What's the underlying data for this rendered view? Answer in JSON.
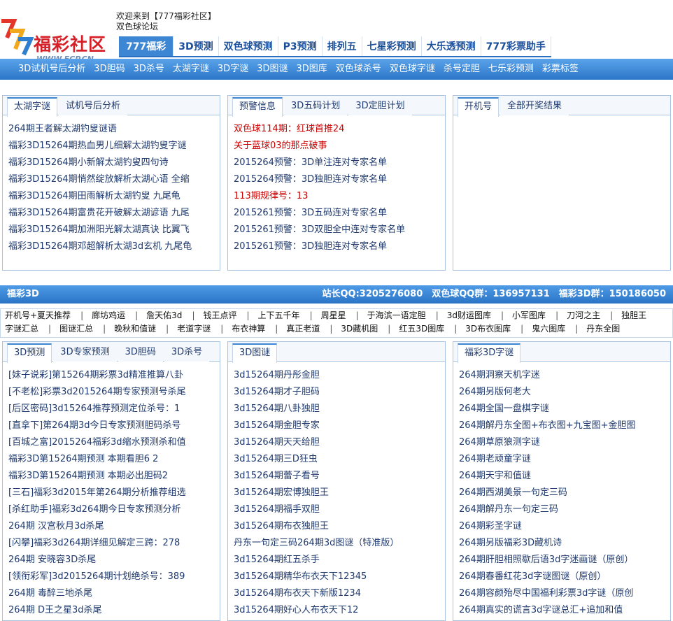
{
  "header": {
    "logo_text": "福彩社区",
    "logo_url": "WWW.FCP.CN",
    "welcome_line1": "欢迎来到【777福彩社区】",
    "welcome_line2": "双色球论坛"
  },
  "main_nav": [
    "777福彩",
    "3D预测",
    "双色球预测",
    "P3预测",
    "排列五",
    "七星彩预测",
    "大乐透预测",
    "777彩票助手"
  ],
  "sub_nav": [
    "3D试机号后分析",
    "3D胆码",
    "3D杀号",
    "太湖字谜",
    "3D字谜",
    "3D图谜",
    "3D图库",
    "双色球杀号",
    "双色球字谜",
    "杀号定胆",
    "七乐彩预测",
    "彩票标签"
  ],
  "box1": {
    "tabs": [
      "太湖字谜",
      "试机号后分析"
    ],
    "items": [
      "264期王者解太湖钓叟谜语",
      "福彩3D15264期热血男儿细解太湖钓叟字谜",
      "福彩3D15264期小新解太湖钓叟四句诗",
      "福彩3D15264期悄然绽放解析太湖心语 全缩",
      "福彩3D15264期田雨解析太湖钓叟 九尾龟",
      "福彩3D15264期富贵花开破解太湖谚语 九尾",
      "福彩3D15264期加洲阳光解太湖真诀 比翼飞",
      "福彩3D15264期邓超解析太湖3d玄机 九尾龟"
    ]
  },
  "box2": {
    "tabs": [
      "预警信息",
      "3D五码计划",
      "3D定胆计划"
    ],
    "items": [
      {
        "text": "双色球114期：红球首推24",
        "red": true
      },
      {
        "text": "关于蓝球03的那点破事",
        "red": true
      },
      {
        "text": "2015264预警：3D单注连对专家名单",
        "red": false
      },
      {
        "text": "2015264预警：3D独胆连对专家名单",
        "red": false
      },
      {
        "text": "113期规律号：13",
        "red": true
      },
      {
        "text": "2015261预警：3D五码连对专家名单",
        "red": false
      },
      {
        "text": "2015261预警：3D双胆全中连对专家名单",
        "red": false
      },
      {
        "text": "2015261预警：3D独胆连对专家名单",
        "red": false
      }
    ]
  },
  "box3": {
    "tabs": [
      "开机号",
      "全部开奖结果"
    ]
  },
  "bar": {
    "title": "福彩3D",
    "info": "站长QQ:3205276080　双色球QQ群：136957131　福彩3D群：150186050"
  },
  "links_row1": [
    "开机号+夏天推荐",
    "廊坊鸡运",
    "詹天佑3d",
    "钱王点评",
    "上下五千年",
    "周星星",
    "于海滨一语定胆",
    "3d财运图库",
    "小军图库",
    "刀河之主",
    "独胆王"
  ],
  "links_row2": [
    "字谜汇总",
    "图谜汇总",
    "晚秋和值谜",
    "老道字谜",
    "布衣神算",
    "真正老道",
    "3D藏机图",
    "红五3D图库",
    "3D布衣图库",
    "鬼六图库",
    "丹东全图"
  ],
  "box4": {
    "tabs": [
      "3D预测",
      "3D专家预测",
      "3D胆码",
      "3D杀号"
    ],
    "items": [
      "[妹子说彩]第15264期彩票3d精准推算八卦",
      "[不老松]彩票3d2015264期专家预测号杀尾",
      "[后区密码]3d15264推荐预测定位杀号：1",
      "[直拿下]第264期3d今日专家预测胆码杀号",
      "[百城之富]2015264福彩3d缩水预测杀和值",
      "福彩3D第15264期预测 本期看胆6 2",
      "福彩3D第15264期预测 本期必出胆码2",
      "[三石]福彩3d2015年第264期分析推荐组选",
      "[杀红助手]福彩3d264期今日专家预测分析",
      "264期 汉宫秋月3d杀尾",
      "[闪攀]福彩3d264期详细见解定三跨：278",
      "264期 安晓容3D杀尾",
      "[领衔彩军]3d2015264期计划绝杀号：389",
      "264期 毒醉三地杀尾",
      "264期 D王之星3d杀尾"
    ]
  },
  "box5": {
    "tabs": [
      "3D图谜"
    ],
    "items": [
      "3d15264期丹彤金胆",
      "3d15264期才子胆码",
      "3d15264期八卦独胆",
      "3d15264期金胆专家",
      "3d15264期天天给胆",
      "3d15264期三D狂虫",
      "3d15264期蕾子看号",
      "3d15264期宏博独胆王",
      "3d15264期福手双胆",
      "3d15264期布衣独胆王",
      "丹东一句定三码264期3d图谜（特准版）",
      "3d15264期红五杀手",
      "3d15264期精华布衣天下12345",
      "3d15264期布衣天下新版1234",
      "3d15264期好心人布衣天下12"
    ]
  },
  "box6": {
    "tabs": [
      "福彩3D字谜"
    ],
    "items": [
      "264期洞察天机字迷",
      "264期另版何老大",
      "264期全国一盘棋字谜",
      "264期解丹东全图+布衣图+九宝图+金胆图",
      "264期草原狼测字谜",
      "264期老顽童字谜",
      "264期天宇和值谜",
      "264期西湖美景一句定三码",
      "264期解丹东一句定三码",
      "264期彩圣字谜",
      "264期另版福彩3D藏机诗",
      "264期肝胆相照歇后语3d字迷画谜（原创）",
      "264期春番红花3d字谜图谜（原创）",
      "264期容颜殆尽中国福利彩票3d字谜（原创",
      "264期真实的谎言3d字谜总汇+追加和值"
    ]
  }
}
